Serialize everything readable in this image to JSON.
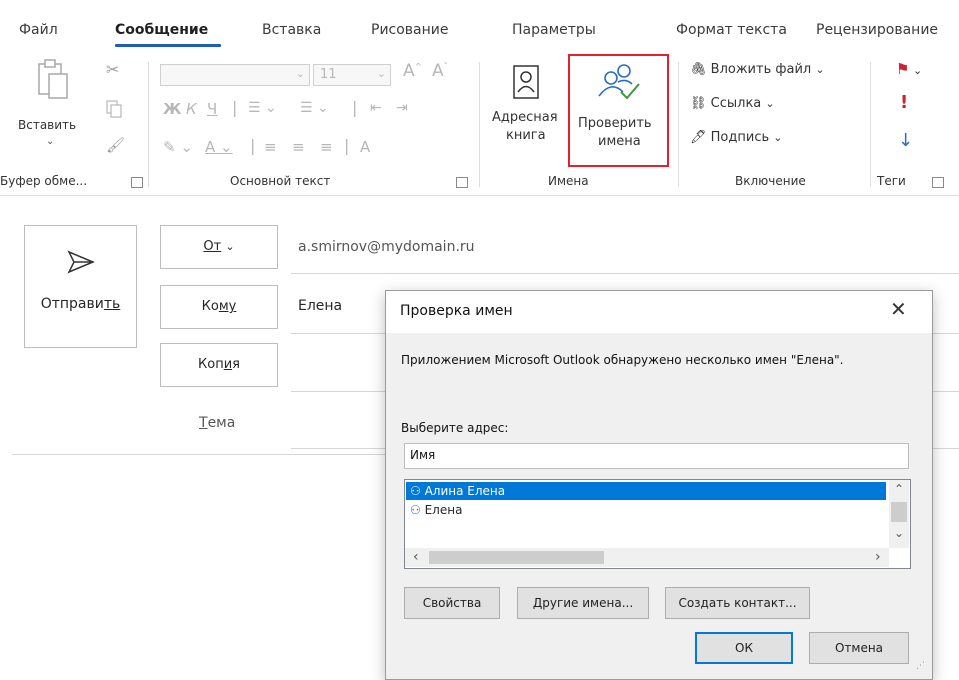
{
  "tabs": [
    "Файл",
    "Сообщение",
    "Вставка",
    "Рисование",
    "Параметры",
    "Формат текста",
    "Рецензирование"
  ],
  "active_tab": "Сообщение",
  "ribbon": {
    "clipboard": {
      "paste_label": "Вставить",
      "group_label": "Буфер обме..."
    },
    "basic_text": {
      "font_size": "11",
      "bold": "Ж",
      "italic": "К",
      "underline": "Ч",
      "group_label": "Основной текст"
    },
    "names": {
      "address_book_line1": "Адресная",
      "address_book_line2": "книга",
      "check_names_line1": "Проверить",
      "check_names_line2": "имена",
      "group_label": "Имена",
      "highlight_color": "#e0212e"
    },
    "include": {
      "attach_file": "Вложить файл",
      "link": "Ссылка",
      "signature": "Подпись",
      "group_label": "Включение"
    },
    "tags": {
      "group_label": "Теги",
      "high_importance": "!"
    }
  },
  "compose": {
    "send_label_main": "Отправи",
    "send_label_underlined": "ть",
    "from_label": "От",
    "from_value": "a.smirnov@mydomain.ru",
    "to_label_pre": "Ко",
    "to_label_underlined": "му",
    "to_value": "Елена",
    "cc_label_pre": "Коп",
    "cc_label_underlined": "и",
    "cc_label_post": "я",
    "subject_label_underlined": "Т",
    "subject_label_post": "ема"
  },
  "dialog": {
    "title": "Проверка имен",
    "message": "Приложением Microsoft Outlook обнаружено несколько имен \"Елена\".",
    "choose_label": "Выберите адрес:",
    "column_header": "Имя",
    "items": [
      "Алина Елена",
      "Елена"
    ],
    "selected_index": 0,
    "buttons": {
      "properties": "Свойства",
      "other_names": "Другие имена...",
      "create_contact": "Создать контакт...",
      "ok": "ОК",
      "cancel": "Отмена"
    },
    "selection_color": "#0078d7"
  }
}
